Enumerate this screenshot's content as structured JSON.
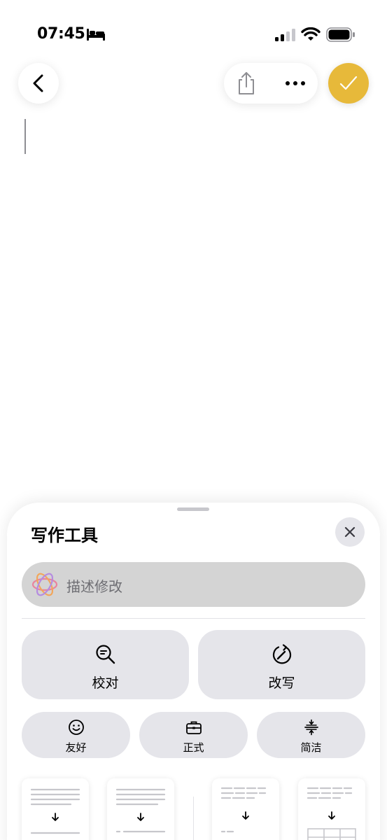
{
  "status_bar": {
    "time": "07:45"
  },
  "icons": {
    "back": "chevron-left-icon",
    "share": "share-icon",
    "more": "ellipsis-icon",
    "done": "checkmark-icon",
    "close": "close-icon",
    "prompt": "apple-intelligence-icon",
    "proofread": "magnifier-text-icon",
    "rewrite": "rewrite-icon",
    "friendly": "smiley-icon",
    "formal": "briefcase-icon",
    "concise": "concise-icon",
    "summary": "down-arrow-icon"
  },
  "colors": {
    "accent": "#e7b93a",
    "tile": "#e5e5ea",
    "field": "#d4d4d4"
  },
  "writing_tools": {
    "title": "写作工具",
    "prompt_placeholder": "描述修改",
    "proofread_label": "校对",
    "rewrite_label": "改写",
    "friendly_label": "友好",
    "formal_label": "正式",
    "concise_label": "简洁"
  }
}
